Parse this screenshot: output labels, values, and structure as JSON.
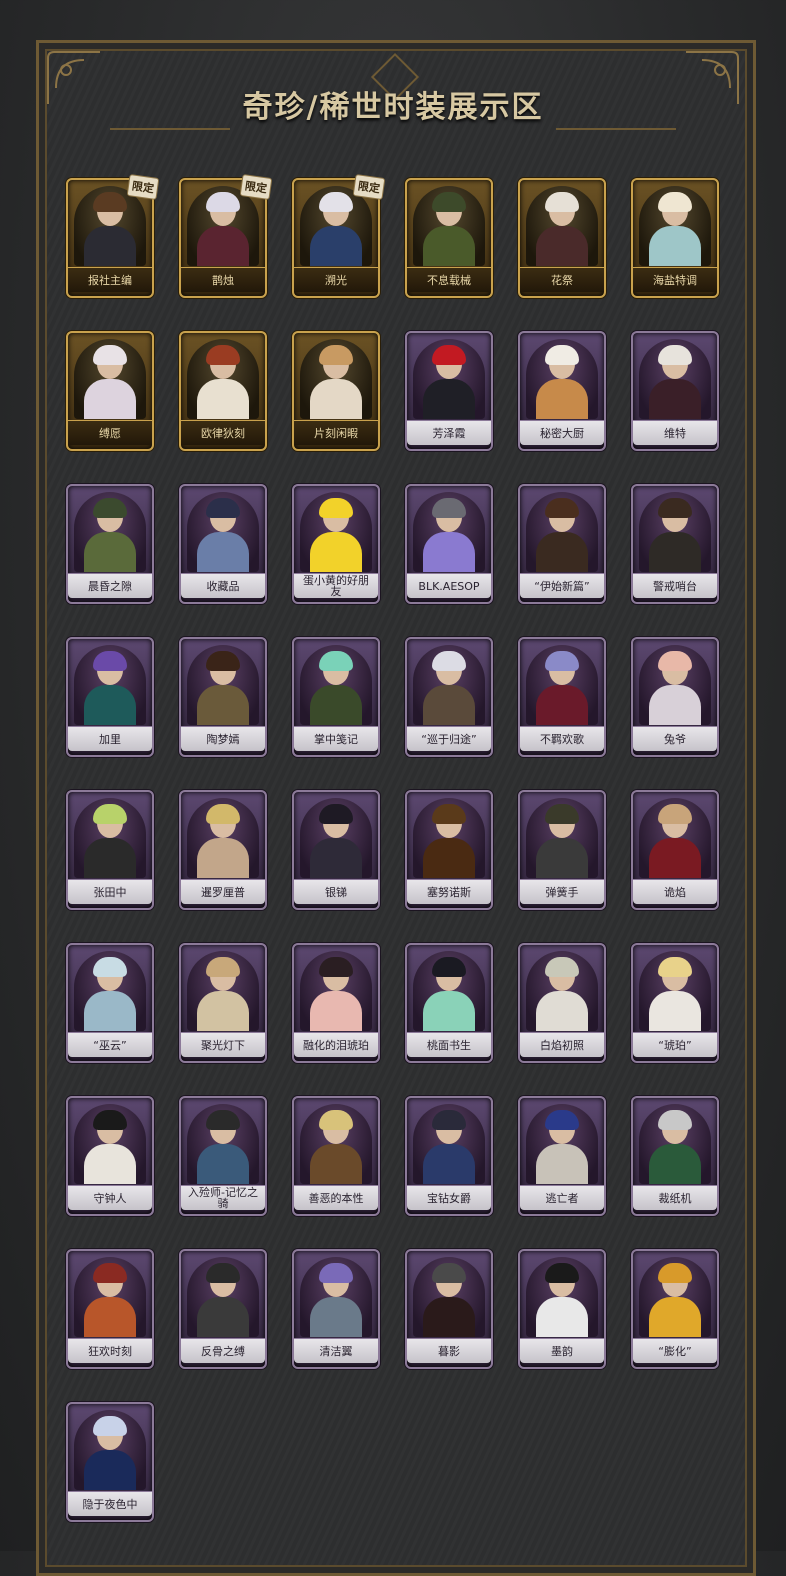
{
  "title": "奇珍/稀世时装展示区",
  "badge_limited": "限定",
  "cards": [
    {
      "name": "报社主编",
      "tier": "gold",
      "badge": "限定",
      "hair": "#5a3b22",
      "outfit": "#2b2b33"
    },
    {
      "name": "鹊烛",
      "tier": "gold",
      "badge": "限定",
      "hair": "#dcd9e6",
      "outfit": "#5a2430"
    },
    {
      "name": "溯光",
      "tier": "gold",
      "badge": "限定",
      "hair": "#e3e1e8",
      "outfit": "#2a3f6a"
    },
    {
      "name": "不息载械",
      "tier": "gold",
      "badge": "",
      "hair": "#3d4a2a",
      "outfit": "#4a5a2a"
    },
    {
      "name": "花祭",
      "tier": "gold",
      "badge": "",
      "hair": "#e6e0d6",
      "outfit": "#4a2a2a"
    },
    {
      "name": "海盐特调",
      "tier": "gold",
      "badge": "",
      "hair": "#efe6d2",
      "outfit": "#9ec6c8"
    },
    {
      "name": "缚愿",
      "tier": "gold",
      "badge": "",
      "hair": "#e8e2e6",
      "outfit": "#ddd3de"
    },
    {
      "name": "欧律狄刻",
      "tier": "gold",
      "badge": "",
      "hair": "#9a3c22",
      "outfit": "#e8e0d0"
    },
    {
      "name": "片刻闲暇",
      "tier": "gold",
      "badge": "",
      "hair": "#c89a62",
      "outfit": "#e4d8c6"
    },
    {
      "name": "芳泽霞",
      "tier": "purple",
      "badge": "",
      "hair": "#c21a22",
      "outfit": "#1f1f26"
    },
    {
      "name": "秘密大厨",
      "tier": "purple",
      "badge": "",
      "hair": "#f0ece4",
      "outfit": "#c78a4a"
    },
    {
      "name": "维特",
      "tier": "purple",
      "badge": "",
      "hair": "#e7e3dc",
      "outfit": "#3a1f28"
    },
    {
      "name": "晨昏之隙",
      "tier": "purple",
      "badge": "",
      "hair": "#3b4a2e",
      "outfit": "#5a6a3a"
    },
    {
      "name": "收藏品",
      "tier": "purple",
      "badge": "",
      "hair": "#2b2f4a",
      "outfit": "#6a7ea8"
    },
    {
      "name": "蛋小黄的好朋友",
      "tier": "purple",
      "badge": "",
      "hair": "#f2d22a",
      "outfit": "#f2d22a"
    },
    {
      "name": "BLK.AESOP",
      "tier": "purple",
      "badge": "",
      "hair": "#6a6a72",
      "outfit": "#8a7ad0"
    },
    {
      "name": "“伊始新篇”",
      "tier": "purple",
      "badge": "",
      "hair": "#4a2e1e",
      "outfit": "#3a2a20"
    },
    {
      "name": "警戒哨台",
      "tier": "purple",
      "badge": "",
      "hair": "#3a2a20",
      "outfit": "#2e2a26"
    },
    {
      "name": "加里",
      "tier": "purple",
      "badge": "",
      "hair": "#6a4aa8",
      "outfit": "#1e5a5a"
    },
    {
      "name": "陶梦嫣",
      "tier": "purple",
      "badge": "",
      "hair": "#3a2418",
      "outfit": "#6a5a3a"
    },
    {
      "name": "掌中笺记",
      "tier": "purple",
      "badge": "",
      "hair": "#7ad2b8",
      "outfit": "#3a4a2a"
    },
    {
      "name": "“巡于归途”",
      "tier": "purple",
      "badge": "",
      "hair": "#dcdce4",
      "outfit": "#5a4a3a"
    },
    {
      "name": "不羁欢歌",
      "tier": "purple",
      "badge": "",
      "hair": "#8a8ac8",
      "outfit": "#6a1a2a"
    },
    {
      "name": "兔爷",
      "tier": "purple",
      "badge": "",
      "hair": "#e8b8a8",
      "outfit": "#d8d0d8"
    },
    {
      "name": "张田中",
      "tier": "purple",
      "badge": "",
      "hair": "#b8d26a",
      "outfit": "#2a2a2a"
    },
    {
      "name": "暹罗厘普",
      "tier": "purple",
      "badge": "",
      "hair": "#d2b86a",
      "outfit": "#c2a68a"
    },
    {
      "name": "银锑",
      "tier": "purple",
      "badge": "",
      "hair": "#1e1a24",
      "outfit": "#2e2a38"
    },
    {
      "name": "塞努诺斯",
      "tier": "purple",
      "badge": "",
      "hair": "#5a3a1a",
      "outfit": "#4a2a12"
    },
    {
      "name": "弹簧手",
      "tier": "purple",
      "badge": "",
      "hair": "#3a3a2a",
      "outfit": "#3a3a3a"
    },
    {
      "name": "诡焰",
      "tier": "purple",
      "badge": "",
      "hair": "#c8a47a",
      "outfit": "#7a1a22"
    },
    {
      "name": "“巫云”",
      "tier": "purple",
      "badge": "",
      "hair": "#c8dce4",
      "outfit": "#9ab8c8"
    },
    {
      "name": "聚光灯下",
      "tier": "purple",
      "badge": "",
      "hair": "#c8a87a",
      "outfit": "#d2c2a2"
    },
    {
      "name": "融化的泪琥珀",
      "tier": "purple",
      "badge": "",
      "hair": "#2a1e22",
      "outfit": "#e8b8b0"
    },
    {
      "name": "桃面书生",
      "tier": "purple",
      "badge": "",
      "hair": "#1a1a22",
      "outfit": "#8ad2b8"
    },
    {
      "name": "白焰初照",
      "tier": "purple",
      "badge": "",
      "hair": "#c8c8b8",
      "outfit": "#e0dcd4"
    },
    {
      "name": "“琥珀”",
      "tier": "purple",
      "badge": "",
      "hair": "#e8d28a",
      "outfit": "#eae6e0"
    },
    {
      "name": "守钟人",
      "tier": "purple",
      "badge": "",
      "hair": "#1a1a1a",
      "outfit": "#e8e4dc"
    },
    {
      "name": "入殓师-记忆之骑",
      "tier": "purple",
      "badge": "",
      "hair": "#2a2a2a",
      "outfit": "#3a5a7a"
    },
    {
      "name": "善恶的本性",
      "tier": "purple",
      "badge": "",
      "hair": "#d8c27a",
      "outfit": "#6a4a2a"
    },
    {
      "name": "宝钻女爵",
      "tier": "purple",
      "badge": "",
      "hair": "#2a2a3a",
      "outfit": "#2a3a6a"
    },
    {
      "name": "逃亡者",
      "tier": "purple",
      "badge": "",
      "hair": "#2a3a8a",
      "outfit": "#c8c2b8"
    },
    {
      "name": "裁纸机",
      "tier": "purple",
      "badge": "",
      "hair": "#c8c8c8",
      "outfit": "#2a5a3a"
    },
    {
      "name": "狂欢时刻",
      "tier": "purple",
      "badge": "",
      "hair": "#8a2a22",
      "outfit": "#b8562a"
    },
    {
      "name": "反骨之缚",
      "tier": "purple",
      "badge": "",
      "hair": "#2a2a2a",
      "outfit": "#3a3a3a"
    },
    {
      "name": "清洁翼",
      "tier": "purple",
      "badge": "",
      "hair": "#7a6ab8",
      "outfit": "#6a7a8a"
    },
    {
      "name": "暮影",
      "tier": "purple",
      "badge": "",
      "hair": "#4a4a4a",
      "outfit": "#2a1a1a"
    },
    {
      "name": "墨韵",
      "tier": "purple",
      "badge": "",
      "hair": "#1a1a1a",
      "outfit": "#e8e8e8"
    },
    {
      "name": "“膨化”",
      "tier": "purple",
      "badge": "",
      "hair": "#d89a2a",
      "outfit": "#e0a82a"
    },
    {
      "name": "隐于夜色中",
      "tier": "purple",
      "badge": "",
      "hair": "#c8d2e8",
      "outfit": "#1a2a5a"
    }
  ]
}
